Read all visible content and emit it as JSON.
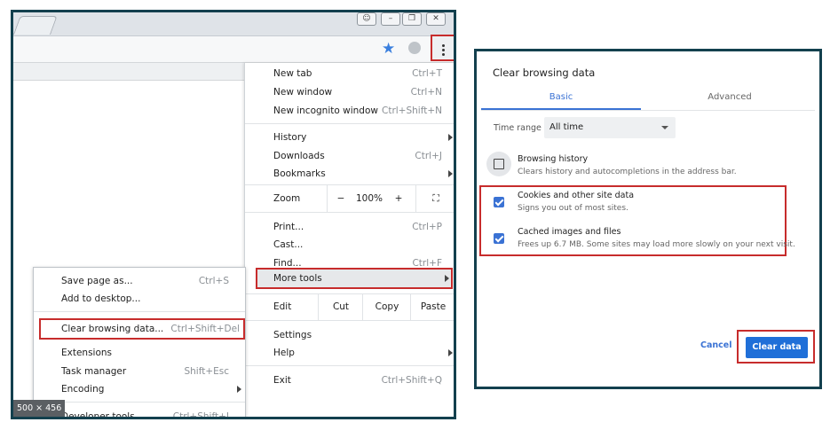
{
  "size_badge": "500 × 456",
  "chrome_menu": {
    "group1": [
      {
        "label": "New tab",
        "shortcut": "Ctrl+T"
      },
      {
        "label": "New window",
        "shortcut": "Ctrl+N"
      },
      {
        "label": "New incognito window",
        "shortcut": "Ctrl+Shift+N"
      }
    ],
    "group2": [
      {
        "label": "History",
        "shortcut": ""
      },
      {
        "label": "Downloads",
        "shortcut": "Ctrl+J"
      },
      {
        "label": "Bookmarks",
        "shortcut": ""
      }
    ],
    "zoom": {
      "label": "Zoom",
      "minus": "−",
      "value": "100%",
      "plus": "+",
      "fullscreen": "⛶"
    },
    "group3": [
      {
        "label": "Print...",
        "shortcut": "Ctrl+P"
      },
      {
        "label": "Cast...",
        "shortcut": ""
      },
      {
        "label": "Find...",
        "shortcut": "Ctrl+F"
      }
    ],
    "more_tools": "More tools",
    "edit": {
      "label": "Edit",
      "cut": "Cut",
      "copy": "Copy",
      "paste": "Paste"
    },
    "group4": [
      {
        "label": "Settings"
      },
      {
        "label": "Help"
      }
    ],
    "exit": {
      "label": "Exit",
      "shortcut": "Ctrl+Shift+Q"
    }
  },
  "submenu": {
    "save_page": {
      "label": "Save page as...",
      "shortcut": "Ctrl+S"
    },
    "add_desktop": {
      "label": "Add to desktop..."
    },
    "clear_browsing": {
      "label": "Clear browsing data...",
      "shortcut": "Ctrl+Shift+Del"
    },
    "extensions": {
      "label": "Extensions"
    },
    "task_manager": {
      "label": "Task manager",
      "shortcut": "Shift+Esc"
    },
    "encoding": {
      "label": "Encoding"
    },
    "developer_tools": {
      "label": "Developer tools",
      "shortcut": "Ctrl+Shift+I"
    }
  },
  "dialog": {
    "title": "Clear browsing data",
    "tab_basic": "Basic",
    "tab_advanced": "Advanced",
    "time_range_label": "Time range",
    "time_range_value": "All time",
    "options": [
      {
        "title": "Browsing history",
        "subtitle": "Clears history and autocompletions in the address bar.",
        "checked": false
      },
      {
        "title": "Cookies and other site data",
        "subtitle": "Signs you out of most sites.",
        "checked": true
      },
      {
        "title": "Cached images and files",
        "subtitle": "Frees up 6.7 MB. Some sites may load more slowly on your next visit.",
        "checked": true
      }
    ],
    "cancel": "Cancel",
    "clear": "Clear data"
  },
  "colors": {
    "frame": "#13404e",
    "highlight": "#c72c2c",
    "accent": "#3a72d4",
    "primary_button": "#1f6fd8"
  }
}
